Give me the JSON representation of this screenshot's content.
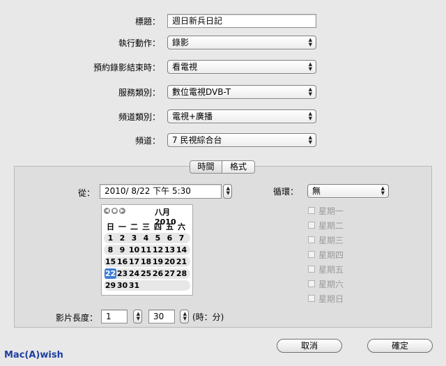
{
  "form": {
    "title_label": "標題：",
    "title_value": "週日新兵日記",
    "action_label": "執行動作：",
    "action_value": "錄影",
    "endtime_label": "預約錄影結束時：",
    "endtime_value": "看電視",
    "service_label": "服務類別：",
    "service_value": "數位電視DVB-T",
    "channeltype_label": "頻道類別：",
    "channeltype_value": "電視+廣播",
    "channel_label": "頻道：",
    "channel_value": "7 民視綜合台"
  },
  "tabs": {
    "time": "時間",
    "format": "格式"
  },
  "schedule": {
    "from_label": "從：",
    "from_value": "2010/  8/22 下午   5:30",
    "repeat_label": "循環：",
    "repeat_value": "無",
    "weekdays": [
      "星期一",
      "星期二",
      "星期三",
      "星期四",
      "星期五",
      "星期六",
      "星期日"
    ],
    "duration_label": "影片長度：",
    "hours": "1",
    "minutes": "30",
    "duration_unit": "(時：分)"
  },
  "calendar": {
    "month_title": "八月 2010",
    "dow": [
      "日",
      "一",
      "二",
      "三",
      "四",
      "五",
      "六"
    ],
    "weeks": [
      [
        "1",
        "2",
        "3",
        "4",
        "5",
        "6",
        "7"
      ],
      [
        "8",
        "9",
        "10",
        "11",
        "12",
        "13",
        "14"
      ],
      [
        "15",
        "16",
        "17",
        "18",
        "19",
        "20",
        "21"
      ],
      [
        "22",
        "23",
        "24",
        "25",
        "26",
        "27",
        "28"
      ],
      [
        "29",
        "30",
        "31",
        "",
        "",
        "",
        ""
      ]
    ],
    "selected_day": "22",
    "accent_color": "#3d7ed6"
  },
  "buttons": {
    "cancel": "取消",
    "ok": "確定"
  },
  "watermark": "Mac(A)wish"
}
